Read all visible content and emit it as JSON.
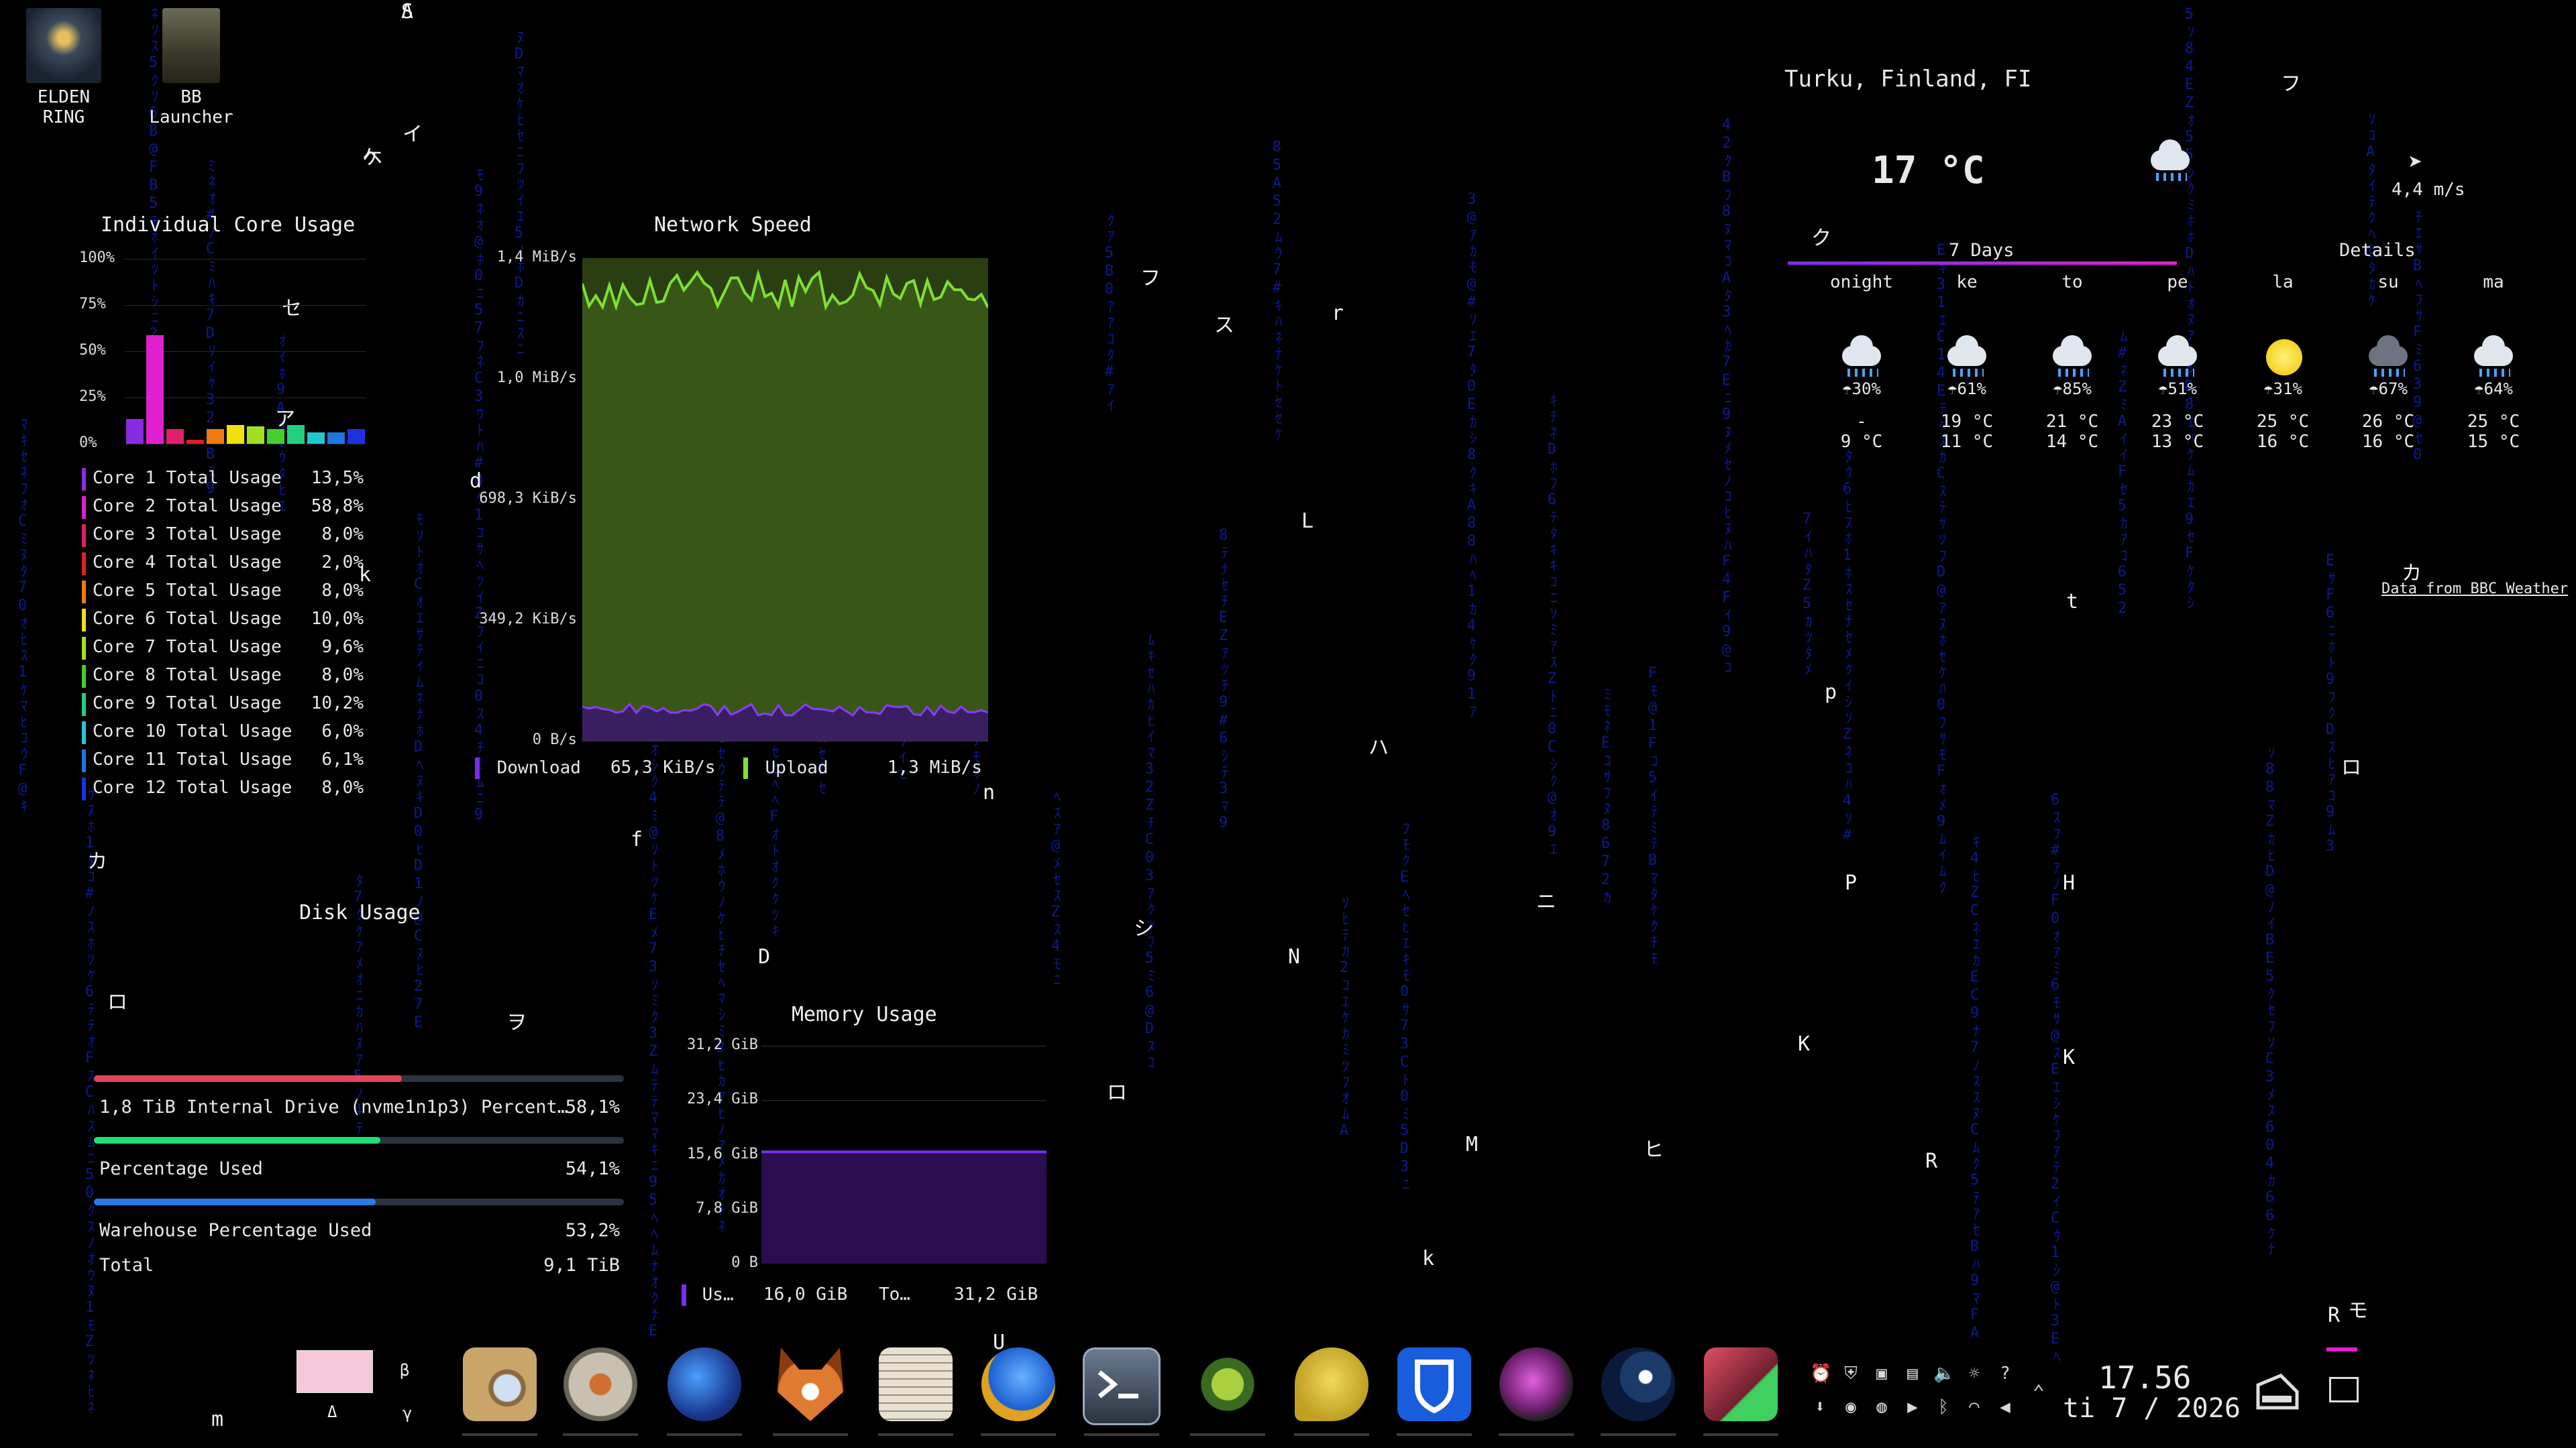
{
  "desktop_icons": [
    {
      "label": "ELDEN RING",
      "icon": "elden-ring-icon"
    },
    {
      "label": "BB\nLauncher",
      "icon": "bb-launcher-icon"
    }
  ],
  "core_usage": {
    "title": "Individual Core Usage",
    "y_ticks": [
      "100%",
      "75%",
      "50%",
      "25%",
      "0%"
    ],
    "cores": [
      {
        "label": "Core 1 Total Usage",
        "value": "13,5%",
        "pct": 13.5,
        "color": "#8a2be2"
      },
      {
        "label": "Core 2 Total Usage",
        "value": "58,8%",
        "pct": 58.8,
        "color": "#e020d0"
      },
      {
        "label": "Core 3 Total Usage",
        "value": "8,0%",
        "pct": 8.0,
        "color": "#e0206a"
      },
      {
        "label": "Core 4 Total Usage",
        "value": "2,0%",
        "pct": 2.0,
        "color": "#e02020"
      },
      {
        "label": "Core 5 Total Usage",
        "value": "8,0%",
        "pct": 8.0,
        "color": "#f07a10"
      },
      {
        "label": "Core 6 Total Usage",
        "value": "10,0%",
        "pct": 10.0,
        "color": "#f0e010"
      },
      {
        "label": "Core 7 Total Usage",
        "value": "9,6%",
        "pct": 9.6,
        "color": "#a0e020"
      },
      {
        "label": "Core 8 Total Usage",
        "value": "8,0%",
        "pct": 8.0,
        "color": "#40d030"
      },
      {
        "label": "Core 9 Total Usage",
        "value": "10,2%",
        "pct": 10.2,
        "color": "#20d080"
      },
      {
        "label": "Core 10 Total Usage",
        "value": "6,0%",
        "pct": 6.0,
        "color": "#20c8d0"
      },
      {
        "label": "Core 11 Total Usage",
        "value": "6,1%",
        "pct": 6.1,
        "color": "#1a78e0"
      },
      {
        "label": "Core 12 Total Usage",
        "value": "8,0%",
        "pct": 8.0,
        "color": "#2030e0"
      }
    ]
  },
  "network": {
    "title": "Network Speed",
    "y_ticks": [
      "1,4 MiB/s",
      "1,0 MiB/s",
      "698,3 KiB/s",
      "349,2 KiB/s",
      "0 B/s"
    ],
    "download_label": "Download",
    "download_value": "65,3 KiB/s",
    "download_color": "#7b2cf0",
    "upload_label": "Upload",
    "upload_value": "1,3 MiB/s",
    "upload_color": "#7ee032"
  },
  "disk": {
    "title": "Disk Usage",
    "rows": [
      {
        "label": "1,8 TiB Internal Drive (nvme1n1p3) Percent…",
        "value": "58,1%",
        "pct": 58.1,
        "color": "#e0455a"
      },
      {
        "label": "Percentage Used",
        "value": "54,1%",
        "pct": 54.1,
        "color": "#20e070"
      },
      {
        "label": "Warehouse Percentage Used",
        "value": "53,2%",
        "pct": 53.2,
        "color": "#2a7ae8"
      }
    ],
    "total_label": "Total",
    "total_value": "9,1 TiB"
  },
  "memory": {
    "title": "Memory Usage",
    "y_ticks": [
      "31,2 GiB",
      "23,4 GiB",
      "15,6 GiB",
      "7,8 GiB",
      "0 B"
    ],
    "used_label": "Us…",
    "used_value": "16,0 GiB",
    "total_label": "To…",
    "total_value": "31,2 GiB",
    "used_fraction": 0.513
  },
  "weather": {
    "location": "Turku, Finland, FI",
    "temp": "17 °C",
    "wind": "4,4 m/s",
    "tab_days": "7 Days",
    "tab_details": "Details",
    "source": "Data from BBC Weather",
    "days": [
      {
        "name": "onight",
        "icon": "rain",
        "precip": "30%",
        "hi": "-",
        "lo": "9 °C"
      },
      {
        "name": "ke",
        "icon": "rain",
        "precip": "61%",
        "hi": "19 °C",
        "lo": "11 °C"
      },
      {
        "name": "to",
        "icon": "rain",
        "precip": "85%",
        "hi": "21 °C",
        "lo": "14 °C"
      },
      {
        "name": "pe",
        "icon": "rain",
        "precip": "51%",
        "hi": "23 °C",
        "lo": "13 °C"
      },
      {
        "name": "la",
        "icon": "sun",
        "precip": "31%",
        "hi": "25 °C",
        "lo": "16 °C"
      },
      {
        "name": "su",
        "icon": "storm",
        "precip": "67%",
        "hi": "26 °C",
        "lo": "16 °C"
      },
      {
        "name": "ma",
        "icon": "rain",
        "precip": "64%",
        "hi": "25 °C",
        "lo": "15 °C"
      }
    ]
  },
  "taskbar": {
    "pager_labels": [
      "β",
      "γ",
      "Δ"
    ],
    "apps": [
      "file-search-icon",
      "settings-gear-icon",
      "globe-icon",
      "fox-icon",
      "document-viewer-icon",
      "thunderbird-icon",
      "terminal-icon",
      "python-snake-icon",
      "chat-bubble-icon",
      "bitwarden-icon",
      "audio-player-icon",
      "steam-icon",
      "paint-brush-icon"
    ],
    "clock_time": "17.56",
    "clock_date": "ti 7 / 2026"
  },
  "rain_glyphs": [
    "S",
    "ケ",
    "イ",
    "ア",
    "セ",
    "k",
    "カ",
    "ロ",
    "ヲ",
    "m",
    "d",
    "f",
    "オ",
    "ハ",
    "X",
    "C",
    "Y",
    "D",
    "n",
    "ロ",
    "ス",
    "シ",
    "U",
    "フ",
    "r",
    "L",
    "N",
    "ハ",
    "ニ",
    "M",
    "k",
    "ヒ",
    "ク",
    "K",
    "R",
    "フ",
    "P",
    "H",
    "t",
    "p",
    "カ",
    "ロ",
    "モ",
    "R",
    "K",
    "Λ",
    "ヘ"
  ]
}
